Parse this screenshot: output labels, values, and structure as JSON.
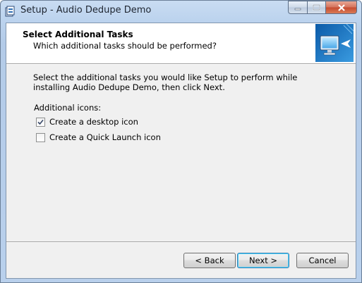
{
  "window": {
    "title": "Setup - Audio Dedupe Demo"
  },
  "caption_buttons": [
    "minimize",
    "maximize",
    "close"
  ],
  "header": {
    "title": "Select Additional Tasks",
    "subtitle": "Which additional tasks should be performed?",
    "image": "computer-install-icon"
  },
  "body": {
    "description": "Select the additional tasks you would like Setup to perform while installing Audio Dedupe Demo, then click Next.",
    "group_label": "Additional icons:",
    "tasks": [
      {
        "label": "Create a desktop icon",
        "checked": true
      },
      {
        "label": "Create a Quick Launch icon",
        "checked": false
      }
    ]
  },
  "buttons": {
    "back": "< Back",
    "next": "Next >",
    "cancel": "Cancel"
  }
}
